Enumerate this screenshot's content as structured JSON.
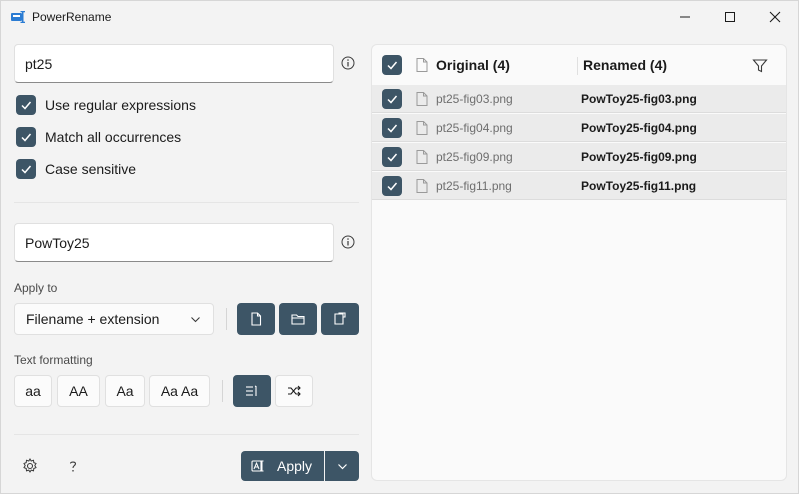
{
  "window": {
    "title": "PowerRename",
    "controls": [
      "minimize-icon",
      "maximize-icon",
      "close-icon"
    ]
  },
  "search": {
    "value": "pt25"
  },
  "options": [
    {
      "label": "Use regular expressions",
      "checked": true
    },
    {
      "label": "Match all occurrences",
      "checked": true
    },
    {
      "label": "Case sensitive",
      "checked": true
    }
  ],
  "replace": {
    "value": "PowToy25"
  },
  "apply_to": {
    "label": "Apply to",
    "selected": "Filename + extension",
    "buttons": [
      "file-icon",
      "folder-icon",
      "subfolder-icon"
    ]
  },
  "text_formatting": {
    "label": "Text formatting",
    "buttons": [
      "aa",
      "AA",
      "Aa",
      "Aa Aa"
    ],
    "toggles": [
      "enumerate-items-icon",
      "randomize-icon"
    ]
  },
  "footer": {
    "apply_label": "Apply"
  },
  "list": {
    "original_header": "Original (4)",
    "renamed_header": "Renamed (4)",
    "rows": [
      {
        "original": "pt25-fig03.png",
        "renamed": "PowToy25-fig03.png",
        "checked": true
      },
      {
        "original": "pt25-fig04.png",
        "renamed": "PowToy25-fig04.png",
        "checked": true
      },
      {
        "original": "pt25-fig09.png",
        "renamed": "PowToy25-fig09.png",
        "checked": true
      },
      {
        "original": "pt25-fig11.png",
        "renamed": "PowToy25-fig11.png",
        "checked": true
      }
    ]
  },
  "colors": {
    "accent": "#3d5566",
    "window_bg": "#f3f3f3",
    "row_bg": "#ebebeb"
  }
}
